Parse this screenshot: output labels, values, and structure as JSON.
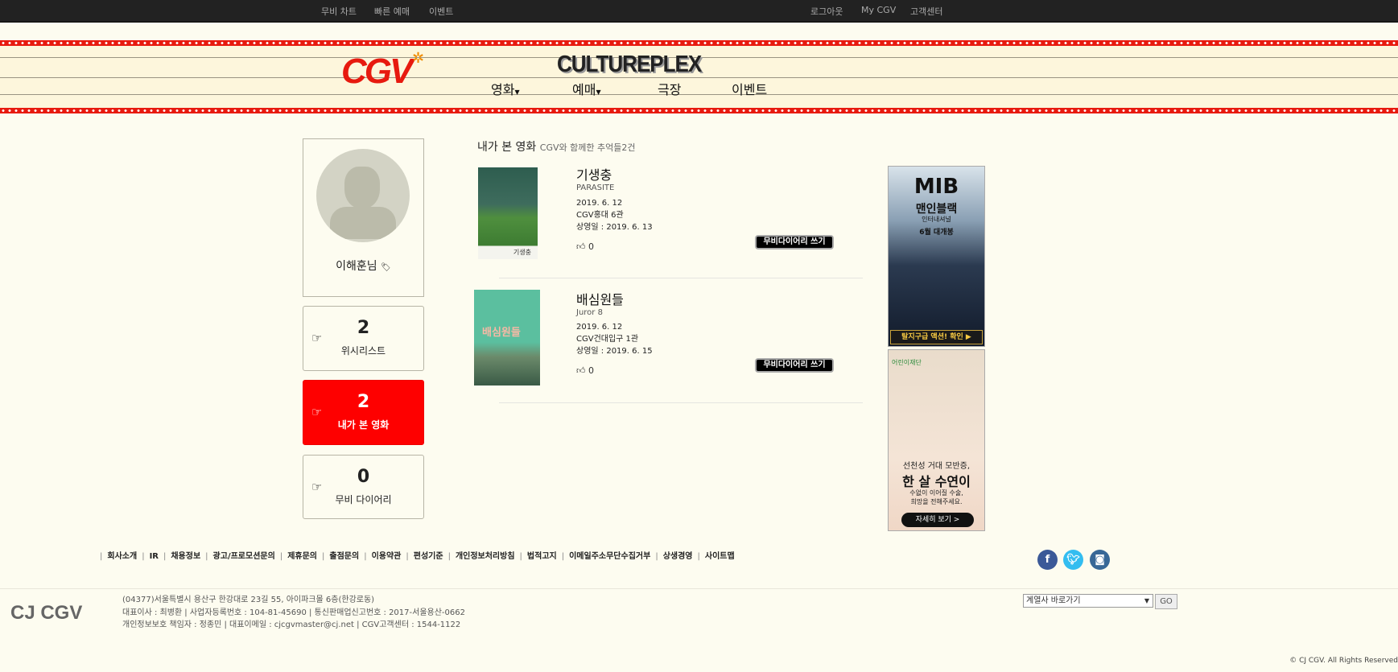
{
  "topbar": {
    "left": [
      "무비 차트",
      "빠른 예매",
      "이벤트"
    ],
    "right": [
      "로그아웃",
      "My CGV",
      "고객센터"
    ]
  },
  "header": {
    "logo": "CGV",
    "subtitle": "CULTUREPLEX",
    "nav": [
      "영화",
      "예매",
      "극장",
      "이벤트"
    ]
  },
  "profile": {
    "name": "이해훈님"
  },
  "stats": [
    {
      "count": "2",
      "label": "위시리스트"
    },
    {
      "count": "2",
      "label": "내가 본 영화"
    },
    {
      "count": "0",
      "label": "무비 다이어리"
    }
  ],
  "section": {
    "title": "내가 본 영화",
    "subtitle": "CGV와 함께한 추억들2건"
  },
  "movies": [
    {
      "title": "기생충",
      "english": "PARASITE",
      "date": "2019. 6. 12",
      "theater": "CGV홍대 6관",
      "release": "상영일 : 2019. 6. 13",
      "likes": "0",
      "button": "무비다이어리 쓰기",
      "poster_text": "기생충"
    },
    {
      "title": "배심원들",
      "english": "Juror 8",
      "date": "2019. 6. 12",
      "theater": "CGV건대입구 1관",
      "release": "상영일 : 2019. 6. 15",
      "likes": "0",
      "button": "무비다이어리 쓰기",
      "poster_text": "배심원들"
    }
  ],
  "ads": [
    {
      "headline": "MIB",
      "sub": "맨인블랙",
      "line": "인터내셔널",
      "date": "6월 대개봉",
      "cta": "탈지구급 액션! 확인 ▶"
    },
    {
      "org": "어린이재단",
      "headline": "선천성 거대 모반증,",
      "name": "한 살 수연이",
      "line1": "수없이 이어질 수술,",
      "line2": "희망을 전해주세요.",
      "cta": "자세히 보기 >"
    }
  ],
  "footer": {
    "links": [
      "회사소개",
      "IR",
      "채용정보",
      "광고/프로모션문의",
      "제휴문의",
      "출점문의",
      "이용약관",
      "편성기준",
      "개인정보처리방침",
      "법적고지",
      "이메일주소무단수집거부",
      "상생경영",
      "사이트맵"
    ],
    "logo": "CJ CGV",
    "address": "(04377)서울특별시 용산구 한강대로 23길 55, 아이파크몰 6층(한강로동)",
    "line2": "대표이사 : 최병환 | 사업자등록번호 : 104-81-45690 | 통신판매업신고번호 : 2017-서울용산-0662",
    "line3": "개인정보보호 책임자 : 정종민 | 대표이메일 : cjcgvmaster@cj.net | CGV고객센터 : 1544-1122",
    "select": "계열사 바로가기",
    "go": "GO",
    "copyright": "© CJ CGV. All Rights Reserved"
  },
  "colors": {
    "brand": "#e71a0f",
    "active": "#fe0000",
    "facebook": "#3b5998",
    "twitter": "#33bdf0",
    "instagram": "#386897"
  }
}
